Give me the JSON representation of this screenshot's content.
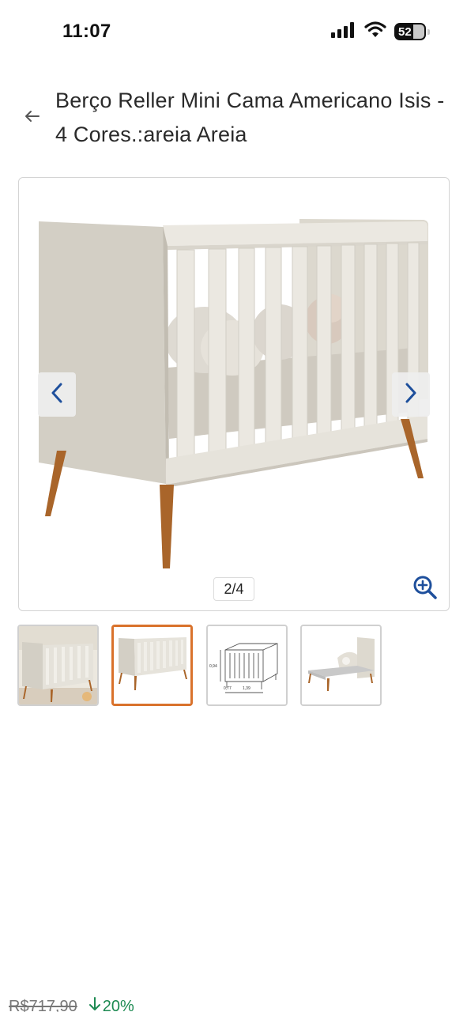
{
  "status_bar": {
    "time": "11:07",
    "battery_level": "52",
    "icons": [
      "signal-icon",
      "wifi-icon",
      "battery-icon"
    ]
  },
  "header": {
    "back_icon": "arrow-left-icon",
    "title": "Berço Reller Mini Cama Americano Isis - 4 Cores.:areia Areia"
  },
  "gallery": {
    "counter": "2/4",
    "prev_icon": "chevron-left-icon",
    "next_icon": "chevron-right-icon",
    "zoom_icon": "zoom-in-icon",
    "current_index": 2,
    "total": 4,
    "thumbnails": [
      {
        "name": "crib-room-photo",
        "selected": false
      },
      {
        "name": "crib-front-photo",
        "selected": true
      },
      {
        "name": "crib-dimension-drawing",
        "selected": false
      },
      {
        "name": "toddler-bed-photo",
        "selected": false
      }
    ],
    "thumb_drawing_labels": [
      "0,94",
      "0,77",
      "1,39"
    ]
  },
  "price": {
    "old": "R$717,90",
    "discount": "20%",
    "discount_icon": "arrow-down-icon"
  },
  "colors": {
    "accent_arrow": "#1e4f9c",
    "selected_border": "#d9722c",
    "discount_green": "#1d8a52",
    "crib_body": "#d6d2c8",
    "crib_slats": "#ebe8e1",
    "wood_legs": "#a9652a"
  }
}
